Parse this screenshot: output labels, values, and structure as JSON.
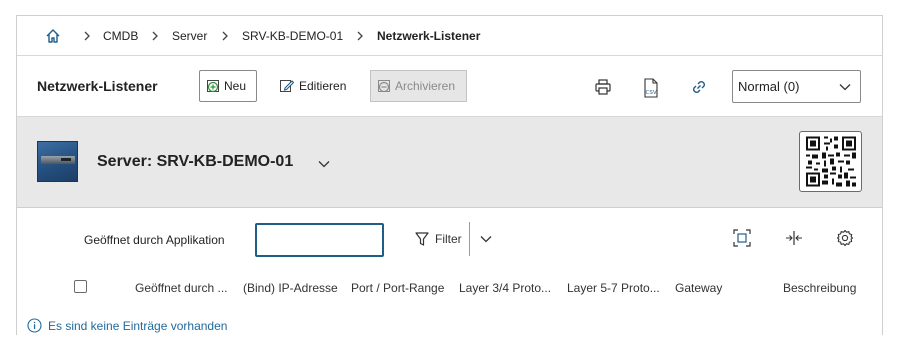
{
  "breadcrumb": {
    "items": [
      "CMDB",
      "Server",
      "SRV-KB-DEMO-01",
      "Netzwerk-Listener"
    ]
  },
  "toolbar": {
    "title": "Netzwerk-Listener",
    "new_label": "Neu",
    "edit_label": "Editieren",
    "archive_label": "Archivieren",
    "view_select": "Normal (0)"
  },
  "object": {
    "title": "Server: SRV-KB-DEMO-01"
  },
  "filter": {
    "field_label": "Geöffnet durch Applikation",
    "input_value": "",
    "filter_label": "Filter"
  },
  "table": {
    "columns": [
      "Geöffnet durch ...",
      "(Bind) IP-Adresse",
      "Port / Port-Range",
      "Layer 3/4 Proto...",
      "Layer 5-7 Proto...",
      "Gateway",
      "Beschreibung"
    ],
    "empty_message": "Es sind keine Einträge vorhanden"
  },
  "colors": {
    "accent": "#1f5e88",
    "info": "#1f6a9c",
    "header_bg": "#e8e8e8"
  },
  "icons": [
    "home-icon",
    "chevron-right-icon",
    "add-icon",
    "edit-icon",
    "archive-icon",
    "print-icon",
    "csv-icon",
    "link-icon",
    "chevron-down-icon",
    "qr-code-icon",
    "filter-icon",
    "fullscreen-icon",
    "column-resize-icon",
    "settings-icon",
    "info-icon"
  ]
}
